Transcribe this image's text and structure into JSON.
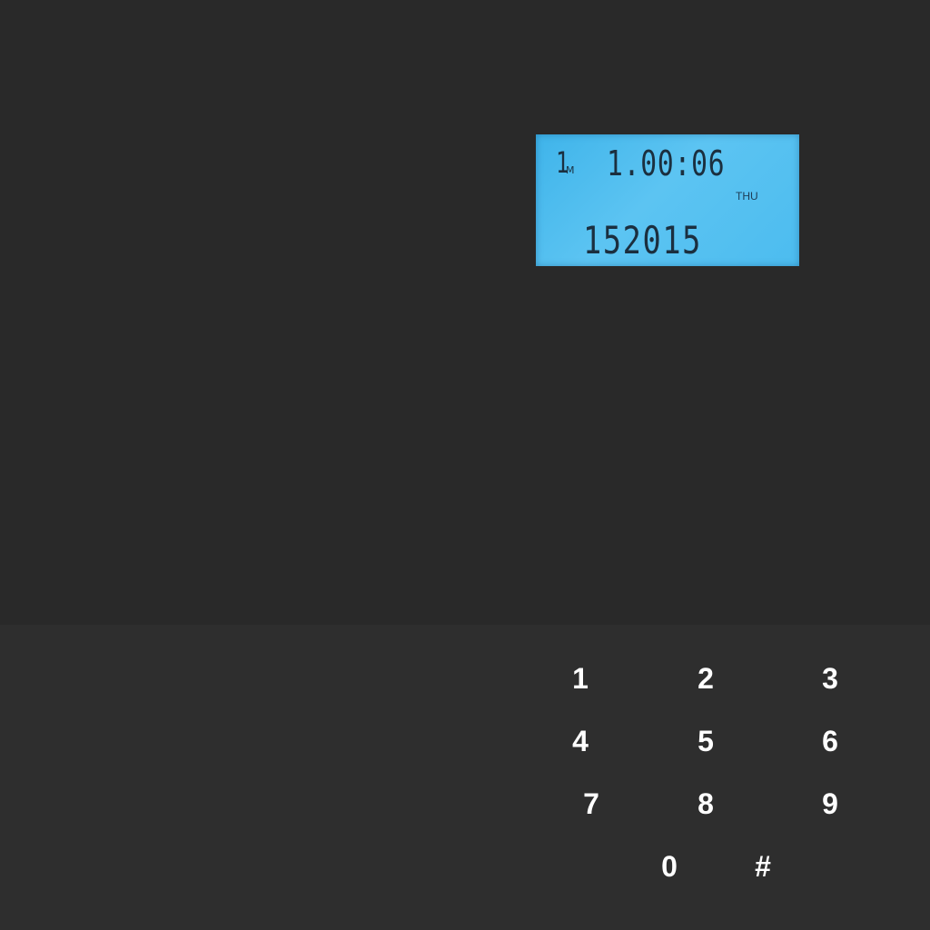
{
  "display": {
    "mode": "1",
    "mode_sub": "M",
    "time": "1.00:06",
    "day": "THU",
    "date": "152015"
  },
  "keypad": {
    "keys": [
      "1",
      "2",
      "3",
      "4",
      "5",
      "6",
      "7",
      "8",
      "9",
      "0",
      "#"
    ]
  },
  "colors": {
    "background": "#2a2a2a",
    "lower_panel": "#2e2e2e",
    "lcd_backlight": "#4cbcef",
    "lcd_text": "#1b2f3f",
    "key_text": "#ffffff"
  }
}
